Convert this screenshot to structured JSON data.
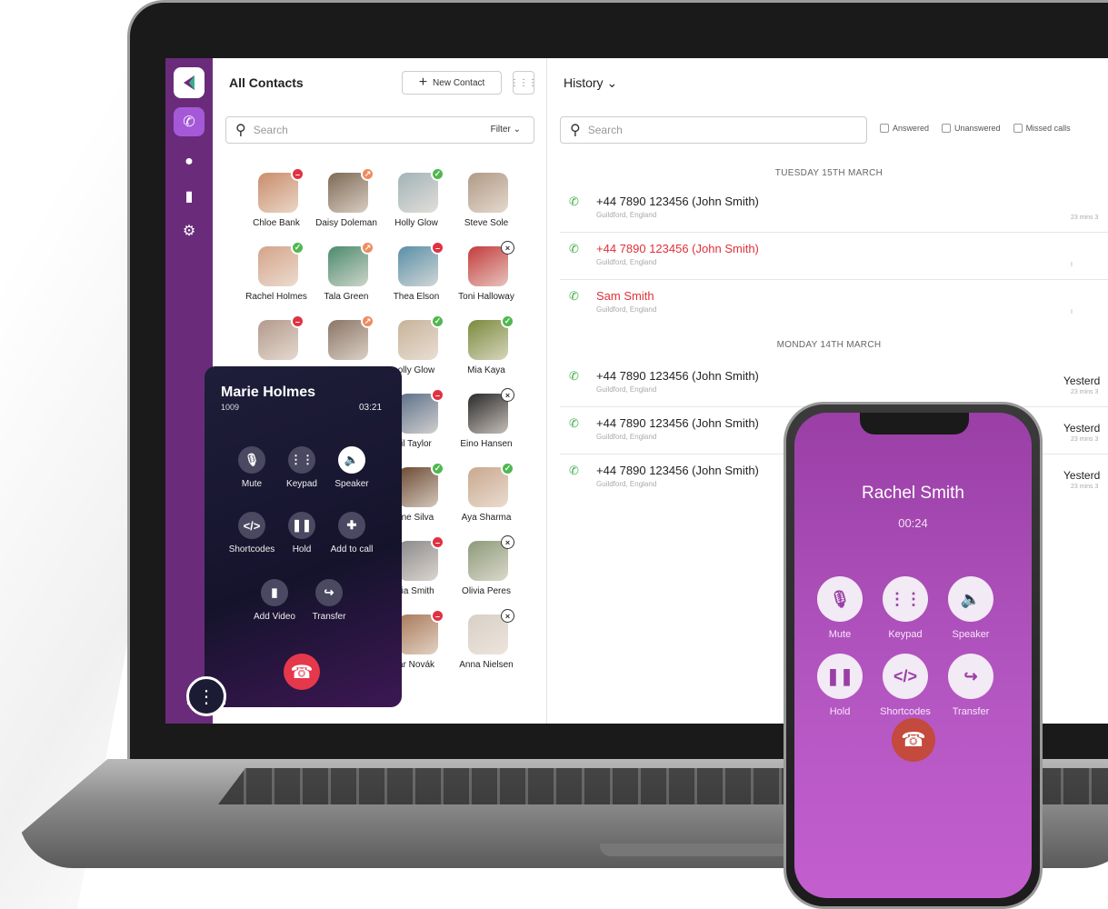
{
  "rail": {
    "items": [
      "logo",
      "phone",
      "chat",
      "video",
      "settings"
    ]
  },
  "contacts": {
    "title": "All Contacts",
    "new_contact_label": "New Contact",
    "search_placeholder": "Search",
    "filter_label": "Filter",
    "list": [
      {
        "name": "Chloe Bank",
        "status": "dnd",
        "color": "#c98d6b"
      },
      {
        "name": "Daisy Doleman",
        "status": "away",
        "color": "#7d6a55"
      },
      {
        "name": "Holly Glow",
        "status": "ok",
        "color": "#a2b3b7"
      },
      {
        "name": "Steve Sole",
        "status": "none",
        "color": "#b09a86"
      },
      {
        "name": "Rachel Holmes",
        "status": "ok",
        "color": "#d4a48a"
      },
      {
        "name": "Tala Green",
        "status": "away",
        "color": "#4c8a6e"
      },
      {
        "name": "Thea Elson",
        "status": "dnd",
        "color": "#5a8fa8"
      },
      {
        "name": "Toni Halloway",
        "status": "off",
        "color": "#c23c3c"
      },
      {
        "name": "",
        "status": "dnd",
        "color": "#b39a8c"
      },
      {
        "name": "",
        "status": "away",
        "color": "#8a7565"
      },
      {
        "name": "olly Glow",
        "status": "ok",
        "color": "#c7b39a"
      },
      {
        "name": "Mia Kaya",
        "status": "ok",
        "color": "#7a8a3c"
      },
      {
        "name": "",
        "status": "none",
        "color": "#eeeeee"
      },
      {
        "name": "",
        "status": "none",
        "color": "#eeeeee"
      },
      {
        "name": "il Taylor",
        "status": "dnd",
        "color": "#5c7089"
      },
      {
        "name": "Eino Hansen",
        "status": "off",
        "color": "#2a2a2a"
      },
      {
        "name": "",
        "status": "none",
        "color": "#eeeeee"
      },
      {
        "name": "",
        "status": "none",
        "color": "#eeeeee"
      },
      {
        "name": "fne Silva",
        "status": "ok",
        "color": "#6b4a32"
      },
      {
        "name": "Aya Sharma",
        "status": "ok",
        "color": "#c9a88e"
      },
      {
        "name": "",
        "status": "none",
        "color": "#eeeeee"
      },
      {
        "name": "",
        "status": "none",
        "color": "#eeeeee"
      },
      {
        "name": "ria Smith",
        "status": "dnd",
        "color": "#8a8a8a"
      },
      {
        "name": "Olivia Peres",
        "status": "off",
        "color": "#8c9a7a"
      },
      {
        "name": "",
        "status": "none",
        "color": "#eeeeee"
      },
      {
        "name": "",
        "status": "none",
        "color": "#eeeeee"
      },
      {
        "name": "ar Novák",
        "status": "dnd",
        "color": "#a87a5a"
      },
      {
        "name": "Anna Nielsen",
        "status": "off",
        "color": "#d8cfc6"
      }
    ]
  },
  "history": {
    "title": "History",
    "search_placeholder": "Search",
    "filters": [
      "Answered",
      "Unanswered",
      "Missed calls"
    ],
    "days": [
      {
        "label": "TUESDAY 15TH MARCH"
      },
      {
        "label": "MONDAY 14TH MARCH"
      }
    ],
    "calls": [
      {
        "number": "+44 7890 123456 (John Smith)",
        "location": "Guildford, England",
        "missed": false,
        "when": "",
        "ago": "23 mins 3"
      },
      {
        "number": "+44 7890 123456 (John Smith)",
        "location": "Guildford, England",
        "missed": true,
        "when": "",
        "ago": "I"
      },
      {
        "number": "Sam Smith",
        "location": "Guildford, England",
        "missed": true,
        "when": "",
        "ago": "I"
      },
      {
        "number": "+44 7890 123456 (John Smith)",
        "location": "Guildford, England",
        "missed": false,
        "when": "Yesterd",
        "ago": "23 mins 3"
      },
      {
        "number": "+44 7890 123456 (John Smith)",
        "location": "Guildford, England",
        "missed": false,
        "when": "Yesterd",
        "ago": "23 mins 3"
      },
      {
        "number": "+44 7890 123456 (John Smith)",
        "location": "Guildford, England",
        "missed": false,
        "when": "Yesterd",
        "ago": "23 mins 3"
      }
    ]
  },
  "active_call": {
    "name": "Marie Holmes",
    "extension": "1009",
    "duration": "03:21",
    "buttons": [
      {
        "label": "Mute",
        "icon": "mic-off-icon"
      },
      {
        "label": "Keypad",
        "icon": "keypad-icon"
      },
      {
        "label": "Speaker",
        "icon": "speaker-icon"
      },
      {
        "label": "Shortcodes",
        "icon": "code-icon"
      },
      {
        "label": "Hold",
        "icon": "pause-icon"
      },
      {
        "label": "Add to call",
        "icon": "add-person-icon"
      },
      {
        "label": "Add Video",
        "icon": "video-icon"
      },
      {
        "label": "Transfer",
        "icon": "transfer-icon"
      }
    ]
  },
  "mobile_call": {
    "name": "Rachel Smith",
    "duration": "00:24",
    "buttons": [
      {
        "label": "Mute",
        "icon": "mic-off-icon"
      },
      {
        "label": "Keypad",
        "icon": "keypad-icon"
      },
      {
        "label": "Speaker",
        "icon": "speaker-icon"
      },
      {
        "label": "Hold",
        "icon": "pause-icon"
      },
      {
        "label": "Shortcodes",
        "icon": "code-icon"
      },
      {
        "label": "Transfer",
        "icon": "transfer-icon"
      }
    ]
  },
  "colors": {
    "brand_purple": "#6a2c7a",
    "accent_purple": "#a559d9",
    "missed_red": "#e0303a",
    "answered_green": "#3cb043",
    "end_call_red": "#e5384b"
  }
}
